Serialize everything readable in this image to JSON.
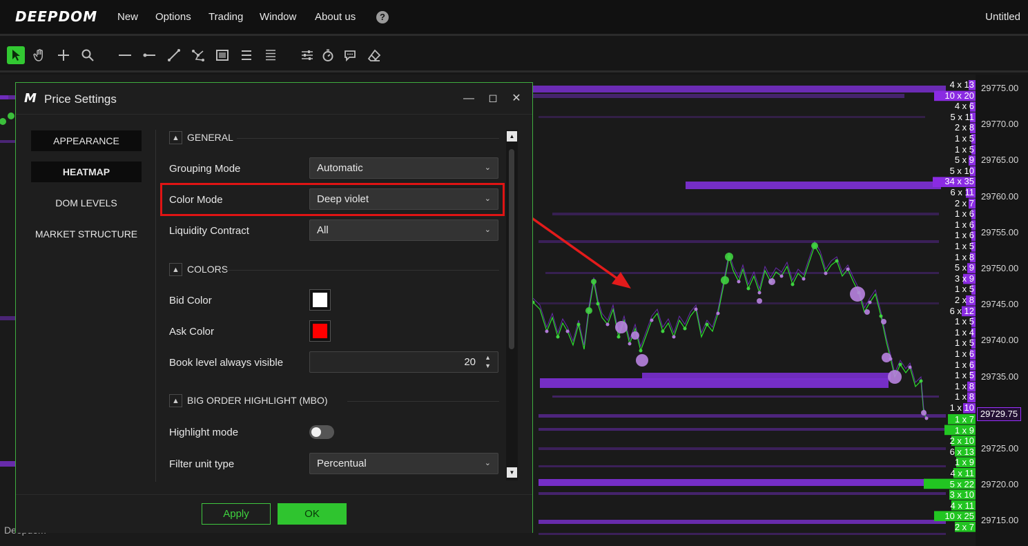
{
  "app": {
    "logo": "DEEPDOM",
    "menu": [
      "New",
      "Options",
      "Trading",
      "Window",
      "About us"
    ],
    "help_icon": "question-circle-icon",
    "document_title": "Untitled"
  },
  "toolbar": {
    "tools": [
      "pointer-icon",
      "hand-icon",
      "crosshair-icon",
      "magnifier-icon",
      "horizontal-line-icon",
      "ray-icon",
      "trend-line-icon",
      "path-icon",
      "rectangle-icon",
      "channel-icon",
      "lines-icon",
      "sliders-icon",
      "stopwatch-icon",
      "comment-icon",
      "eraser-icon"
    ],
    "active_tool": "pointer-icon"
  },
  "chart": {
    "watermark": "Deepdom",
    "price_labels": [
      "29775.00",
      "29770.00",
      "29765.00",
      "29760.00",
      "29755.00",
      "29750.00",
      "29745.00",
      "29740.00",
      "29735.00",
      "29730.00",
      "29725.00",
      "29720.00",
      "29715.00"
    ],
    "current_price": "29729.75",
    "dom_ask_sizes": [
      "4 x 13",
      "10 x 20",
      "4 x 6",
      "5 x 11",
      "2 x 8",
      "1 x 5",
      "1 x 5",
      "5 x 9",
      "5 x 10",
      "34 x 35",
      "6 x 11",
      "2 x 7",
      "1 x 6",
      "1 x 6",
      "1 x 6",
      "1 x 5",
      "1 x 8",
      "5 x 9",
      "3 x 9",
      "1 x 5",
      "2 x 8",
      "6 x 12",
      "1 x 5",
      "1 x 4",
      "1 x 5",
      "1 x 6",
      "1 x 6",
      "1 x 5",
      "1 x 8",
      "1 x 8",
      "1 x 10"
    ],
    "dom_bid_sizes": [
      "1 x 7",
      "1 x 9",
      "2 x 10",
      "6 x 13",
      "1 x 9",
      "4 x 11",
      "5 x 22",
      "3 x 10",
      "4 x 11",
      "10 x 25",
      "2 x 7"
    ],
    "colors": {
      "ask": "#8a2be2",
      "bid": "#22c522",
      "heat": "#7a2fd0",
      "line": "#2ee02e"
    }
  },
  "dialog": {
    "logo": "M",
    "title": "Price Settings",
    "nav": [
      "APPEARANCE",
      "HEATMAP",
      "DOM LEVELS",
      "MARKET STRUCTURE"
    ],
    "active_nav": "HEATMAP",
    "sections": {
      "general": "GENERAL",
      "colors": "COLORS",
      "big_order": "BIG ORDER HIGHLIGHT (MBO)"
    },
    "fields": {
      "grouping_mode": {
        "label": "Grouping Mode",
        "value": "Automatic"
      },
      "color_mode": {
        "label": "Color Mode",
        "value": "Deep violet"
      },
      "liquidity_contract": {
        "label": "Liquidity Contract",
        "value": "All"
      },
      "bid_color": {
        "label": "Bid Color",
        "value": "#ffffff"
      },
      "ask_color": {
        "label": "Ask Color",
        "value": "#ff0000"
      },
      "book_level": {
        "label": "Book level always visible",
        "value": "20"
      },
      "highlight_mode": {
        "label": "Highlight mode",
        "value": "off"
      },
      "filter_unit_type": {
        "label": "Filter unit type",
        "value": "Percentual"
      }
    },
    "buttons": {
      "apply": "Apply",
      "ok": "OK"
    }
  }
}
